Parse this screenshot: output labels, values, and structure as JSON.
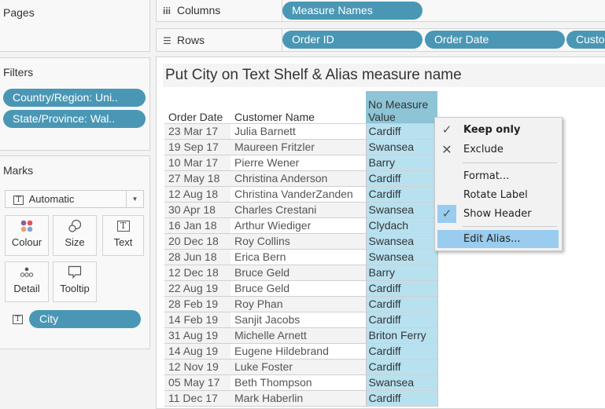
{
  "pages": {
    "title": "Pages"
  },
  "filters": {
    "title": "Filters",
    "items": [
      "Country/Region: Uni..",
      "State/Province: Wal.."
    ]
  },
  "marks": {
    "title": "Marks",
    "mark_type": "Automatic",
    "buttons": [
      {
        "label": "Colour",
        "icon": "colour-dots-icon"
      },
      {
        "label": "Size",
        "icon": "size-circles-icon"
      },
      {
        "label": "Text",
        "icon": "text-icon"
      },
      {
        "label": "Detail",
        "icon": "detail-dots-icon"
      },
      {
        "label": "Tooltip",
        "icon": "tooltip-bubble-icon"
      }
    ],
    "fields": [
      {
        "label": "City",
        "type": "text"
      }
    ]
  },
  "shelves": {
    "columns": {
      "label": "Columns",
      "pills": [
        "Measure Names"
      ]
    },
    "rows": {
      "label": "Rows",
      "pills": [
        "Order ID",
        "Order Date",
        "Custo"
      ]
    }
  },
  "viz": {
    "title": "Put City on Text Shelf & Alias measure name",
    "headers": {
      "order_date": "Order Date",
      "customer_name": "Customer Name",
      "measure": "No Measure\nValue"
    },
    "rows": [
      {
        "date": "23 Mar 17",
        "name": "Julia Barnett",
        "city": "Cardiff"
      },
      {
        "date": "19 Sep 17",
        "name": "Maureen Fritzler",
        "city": "Swansea"
      },
      {
        "date": "10 Mar 17",
        "name": "Pierre Wener",
        "city": "Barry"
      },
      {
        "date": "27 May 18",
        "name": "Christina Anderson",
        "city": "Cardiff"
      },
      {
        "date": "12 Aug 18",
        "name": "Christina VanderZanden",
        "city": "Cardiff"
      },
      {
        "date": "30 Apr 18",
        "name": "Charles Crestani",
        "city": "Swansea"
      },
      {
        "date": "16 Jan 18",
        "name": "Arthur Wiediger",
        "city": "Clydach"
      },
      {
        "date": "20 Dec 18",
        "name": "Roy Collins",
        "city": "Swansea"
      },
      {
        "date": "28 Jun 18",
        "name": "Erica Bern",
        "city": "Swansea"
      },
      {
        "date": "12 Dec 18",
        "name": "Bruce Geld",
        "city": "Barry"
      },
      {
        "date": "22 Aug 19",
        "name": "Bruce Geld",
        "city": "Cardiff"
      },
      {
        "date": "28 Feb 19",
        "name": "Roy Phan",
        "city": "Cardiff"
      },
      {
        "date": "14 Feb 19",
        "name": "Sanjit Jacobs",
        "city": "Cardiff"
      },
      {
        "date": "31 Aug 19",
        "name": "Michelle Arnett",
        "city": "Briton Ferry"
      },
      {
        "date": "14 Aug 19",
        "name": "Eugene Hildebrand",
        "city": "Cardiff"
      },
      {
        "date": "12 Nov 19",
        "name": "Luke Foster",
        "city": "Cardiff"
      },
      {
        "date": "05 May 17",
        "name": "Beth Thompson",
        "city": "Swansea"
      },
      {
        "date": "11 Dec 17",
        "name": "Mark Haberlin",
        "city": "Cardiff"
      }
    ]
  },
  "context_menu": {
    "items": [
      {
        "label": "Keep only",
        "icon": "check-icon",
        "bold": true
      },
      {
        "label": "Exclude",
        "icon": "x-icon"
      },
      {
        "separator": true
      },
      {
        "label": "Format..."
      },
      {
        "label": "Rotate Label"
      },
      {
        "label": "Show Header",
        "icon": "check-icon",
        "checked": true
      },
      {
        "separator": true
      },
      {
        "label": "Edit Alias...",
        "highlighted": true
      }
    ]
  },
  "colors": {
    "pill": "#4a97b5",
    "measure_header": "#8dc4d6",
    "measure_cell": "#b8e1f0",
    "menu_highlight": "#99ccee"
  }
}
